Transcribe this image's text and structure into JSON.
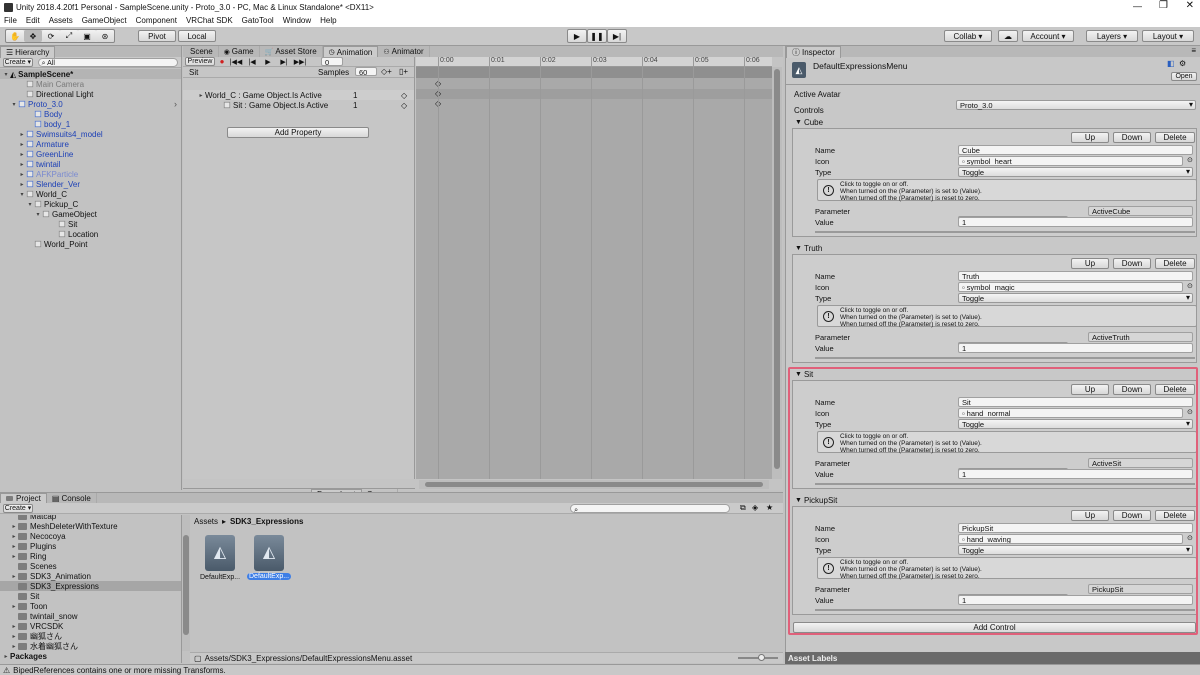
{
  "window": {
    "title": "Unity 2018.4.20f1 Personal - SampleScene.unity - Proto_3.0 - PC, Mac & Linux Standalone* <DX11>"
  },
  "menu": [
    "File",
    "Edit",
    "Assets",
    "GameObject",
    "Component",
    "VRChat SDK",
    "GatoTool",
    "Window",
    "Help"
  ],
  "toolbar": {
    "pivot": "Pivot",
    "local": "Local",
    "collab": "Collab ▾",
    "account": "Account",
    "layers": "Layers",
    "layout": "Layout"
  },
  "hierarchy": {
    "tab": "Hierarchy",
    "create": "Create ▾",
    "search_placeholder": "All",
    "items": [
      "SampleScene*",
      "Main Camera",
      "Directional Light",
      "Proto_3.0",
      "Body",
      "body_1",
      "Swimsuits4_model",
      "Armature",
      "GreenLine",
      "twintail",
      "AFKParticle",
      "Slender_Ver",
      "World_C",
      "Pickup_C",
      "GameObject",
      "Sit",
      "Location",
      "World_Point"
    ]
  },
  "center_tabs": [
    "Scene",
    "Game",
    "Asset Store",
    "Animation",
    "Animator"
  ],
  "animation": {
    "preview": "Preview",
    "clip": "Sit",
    "samples_label": "Samples",
    "samples": "60",
    "frame": "0",
    "time_ticks": [
      "0:00",
      "0:01",
      "0:02",
      "0:03",
      "0:04",
      "0:05",
      "0:06"
    ],
    "props": [
      {
        "name": "World_C : Game Object.Is Active",
        "value": "1"
      },
      {
        "name": "Sit : Game Object.Is Active",
        "value": "1"
      }
    ],
    "add_property": "Add Property",
    "dopesheet": "Dopesheet",
    "curves": "Curves"
  },
  "project": {
    "tabs": [
      "Project",
      "Console"
    ],
    "create": "Create ▾",
    "folders": [
      "Matcap",
      "MeshDeleterWithTexture",
      "Necocoya",
      "Plugins",
      "Ring",
      "Scenes",
      "SDK3_Animation",
      "SDK3_Expressions",
      "Sit",
      "Toon",
      "twintail_snow",
      "VRCSDK",
      "幽狐さん",
      "水着幽狐さん",
      "Packages"
    ],
    "breadcrumb": [
      "Assets",
      "SDK3_Expressions"
    ],
    "assets": [
      "DefaultExp...",
      "DefaultExp..."
    ],
    "path": "Assets/SDK3_Expressions/DefaultExpressionsMenu.asset"
  },
  "status": {
    "message": "BipedReferences contains one or more missing Transforms."
  },
  "inspector": {
    "tab": "Inspector",
    "title": "DefaultExpressionsMenu",
    "open": "Open",
    "active_avatar_label": "Active Avatar",
    "active_avatar": "Proto_3.0",
    "controls_label": "Controls",
    "labels": {
      "name": "Name",
      "icon": "Icon",
      "type": "Type",
      "parameter": "Parameter",
      "value": "Value",
      "up": "Up",
      "down": "Down",
      "delete": "Delete"
    },
    "help": [
      "Click to toggle on or off.",
      "When turned on the (Parameter) is set to (Value).",
      "When turned off the (Parameter) is reset to zero."
    ],
    "controls": [
      {
        "header": "Cube",
        "name": "Cube",
        "icon": "symbol_heart",
        "type": "Toggle",
        "param": "ActiveCube, Int",
        "param_name": "ActiveCube",
        "value": "1"
      },
      {
        "header": "Truth",
        "name": "Truth",
        "icon": "symbol_magic",
        "type": "Toggle",
        "param": "ActiveTruth, Int",
        "param_name": "ActiveTruth",
        "value": "1"
      },
      {
        "header": "Sit",
        "name": "Sit",
        "icon": "hand_normal",
        "type": "Toggle",
        "param": "ActiveSit, Int",
        "param_name": "ActiveSit",
        "value": "1"
      },
      {
        "header": "PickupSit",
        "name": "PickupSit",
        "icon": "hand_waving",
        "type": "Toggle",
        "param": "PickupSit, Int",
        "param_name": "PickupSit",
        "value": "1"
      }
    ],
    "add_control": "Add Control",
    "asset_labels": "Asset Labels"
  },
  "colors": {
    "highlight": "#e0607a",
    "selection": "#3d7ee6"
  }
}
